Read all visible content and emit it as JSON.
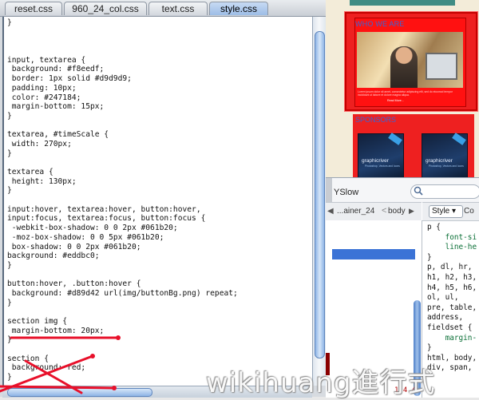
{
  "editor": {
    "tabs": [
      {
        "label": "reset.css",
        "active": false
      },
      {
        "label": "960_24_col.css",
        "active": false
      },
      {
        "label": "text.css",
        "active": false
      },
      {
        "label": "style.css",
        "active": true
      }
    ],
    "code_lines": [
      "}",
      "",
      "",
      "",
      "input, textarea {",
      " background: #f8eedf;",
      " border: 1px solid #d9d9d9;",
      " padding: 10px;",
      " color: #247184;",
      " margin-bottom: 15px;",
      "}",
      "",
      "textarea, #timeScale {",
      " width: 270px;",
      "}",
      "",
      "textarea {",
      " height: 130px;",
      "}",
      "",
      "input:hover, textarea:hover, button:hover,",
      "input:focus, textarea:focus, button:focus {",
      " -webkit-box-shadow: 0 0 2px #061b20;",
      " -moz-box-shadow: 0 0 5px #061b20;",
      " box-shadow: 0 0 2px #061b20;",
      "background: #eddbc0;",
      "}",
      "",
      "button:hover, .button:hover {",
      " background: #d89d42 url(img/buttonBg.png) repeat;",
      "}",
      "",
      "section img {",
      " margin-bottom: 20px;",
      "}",
      "",
      "section {",
      " background: red;",
      "}"
    ],
    "annotation_color": "#e8102a"
  },
  "preview": {
    "about_heading": "WHO WE ARE",
    "about_text": "Lorem ipsum dolor sit amet, consectetur adipiscing elit, sed do eiusmod tempor incididunt ut labore et dolore magna aliqua.",
    "read_more": "Read More...",
    "sponsors_heading": "SPONSORS",
    "sponsors": [
      {
        "name": "graphicriver",
        "tags": "Photoshop, Vectors and Icons"
      },
      {
        "name": "graphicriver",
        "tags": "Photoshop, Vectors and Icons"
      }
    ],
    "panel_color": "#ee2020",
    "heading_color": "#3866d6"
  },
  "devtools": {
    "yslow_label": "YSlow",
    "breadcrumb": {
      "back": "◀",
      "first": "...ainer_24",
      "second": "body",
      "next": "▶"
    },
    "dom_number": "1.4.4",
    "style_tab": "Style ▾",
    "computed_tab": "Co",
    "style_lines": [
      "p {",
      "    font-si",
      "    line-he",
      "}",
      "p, dl, hr,",
      "h1, h2, h3,",
      "h4, h5, h6,",
      "ol, ul,",
      "pre, table,",
      "address,",
      "fieldset {",
      "    margin-",
      "}",
      "html, body,",
      "div, span,"
    ]
  },
  "watermark": "wikihuang進行式"
}
